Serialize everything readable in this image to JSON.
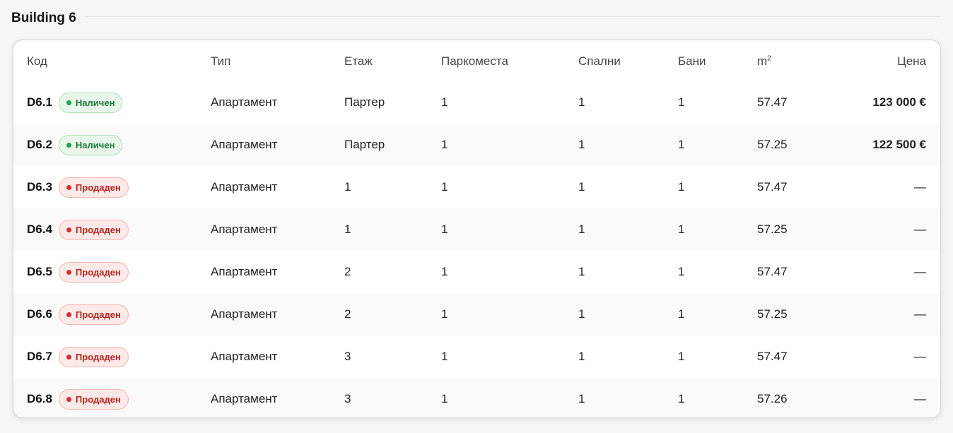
{
  "section": {
    "title": "Building 6"
  },
  "table": {
    "headers": {
      "code": "Код",
      "type": "Тип",
      "floor": "Етаж",
      "parking": "Паркоместа",
      "bedrooms": "Спални",
      "bathrooms": "Бани",
      "area_base": "m",
      "area_sup": "2",
      "price": "Цена"
    },
    "rows": [
      {
        "code": "D6.1",
        "status": "Наличен",
        "status_kind": "available",
        "type": "Апартамент",
        "floor": "Партер",
        "parking": "1",
        "bedrooms": "1",
        "bathrooms": "1",
        "area": "57.47",
        "price": "123 000 €"
      },
      {
        "code": "D6.2",
        "status": "Наличен",
        "status_kind": "available",
        "type": "Апартамент",
        "floor": "Партер",
        "parking": "1",
        "bedrooms": "1",
        "bathrooms": "1",
        "area": "57.25",
        "price": "122 500 €"
      },
      {
        "code": "D6.3",
        "status": "Продаден",
        "status_kind": "sold",
        "type": "Апартамент",
        "floor": "1",
        "parking": "1",
        "bedrooms": "1",
        "bathrooms": "1",
        "area": "57.47",
        "price": "—"
      },
      {
        "code": "D6.4",
        "status": "Продаден",
        "status_kind": "sold",
        "type": "Апартамент",
        "floor": "1",
        "parking": "1",
        "bedrooms": "1",
        "bathrooms": "1",
        "area": "57.25",
        "price": "—"
      },
      {
        "code": "D6.5",
        "status": "Продаден",
        "status_kind": "sold",
        "type": "Апартамент",
        "floor": "2",
        "parking": "1",
        "bedrooms": "1",
        "bathrooms": "1",
        "area": "57.47",
        "price": "—"
      },
      {
        "code": "D6.6",
        "status": "Продаден",
        "status_kind": "sold",
        "type": "Апартамент",
        "floor": "2",
        "parking": "1",
        "bedrooms": "1",
        "bathrooms": "1",
        "area": "57.25",
        "price": "—"
      },
      {
        "code": "D6.7",
        "status": "Продаден",
        "status_kind": "sold",
        "type": "Апартамент",
        "floor": "3",
        "parking": "1",
        "bedrooms": "1",
        "bathrooms": "1",
        "area": "57.47",
        "price": "—"
      },
      {
        "code": "D6.8",
        "status": "Продаден",
        "status_kind": "sold",
        "type": "Апартамент",
        "floor": "3",
        "parking": "1",
        "bedrooms": "1",
        "bathrooms": "1",
        "area": "57.26",
        "price": "—"
      }
    ]
  },
  "colors": {
    "available_bg": "#e8f6ec",
    "available_text": "#1f7a3a",
    "sold_bg": "#fde9e7",
    "sold_text": "#b3261e"
  }
}
